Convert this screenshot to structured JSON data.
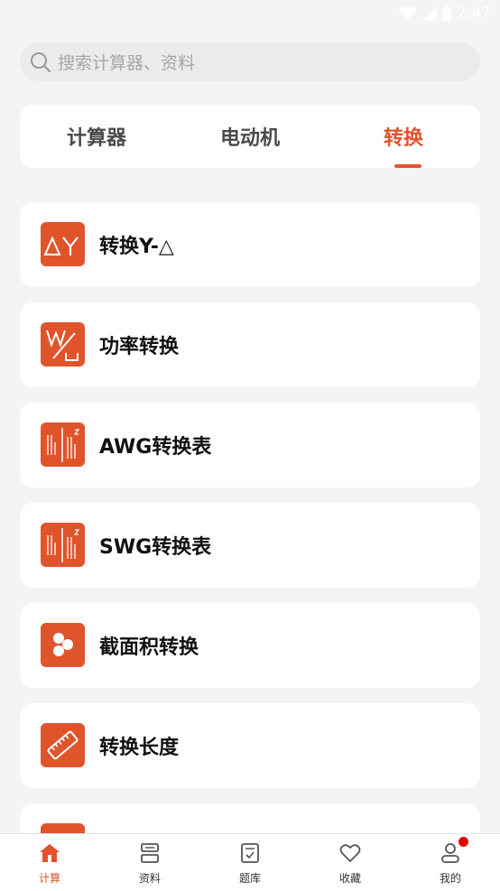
{
  "status_bar": {
    "time": "2:47"
  },
  "search": {
    "placeholder": "搜索计算器、资料"
  },
  "tabs": [
    {
      "label": "计算器"
    },
    {
      "label": "电动机"
    },
    {
      "label": "转换"
    }
  ],
  "active_tab": "转换",
  "items": [
    {
      "label": "转换Y-△",
      "icon": "delta-y-icon"
    },
    {
      "label": "功率转换",
      "icon": "power-w-icon"
    },
    {
      "label": "AWG转换表",
      "icon": "awg-table-icon"
    },
    {
      "label": "SWG转换表",
      "icon": "swg-table-icon"
    },
    {
      "label": "截面积转换",
      "icon": "cross-section-icon"
    },
    {
      "label": "转换长度",
      "icon": "ruler-icon"
    }
  ],
  "bottom_nav": [
    {
      "label": "计算",
      "icon": "home-icon"
    },
    {
      "label": "资料",
      "icon": "books-icon"
    },
    {
      "label": "题库",
      "icon": "question-bank-icon"
    },
    {
      "label": "收藏",
      "icon": "heart-icon"
    },
    {
      "label": "我的",
      "icon": "profile-icon"
    }
  ],
  "colors": {
    "accent": "#e0542c",
    "background": "#f4f4f4",
    "notification": "#e80000"
  }
}
